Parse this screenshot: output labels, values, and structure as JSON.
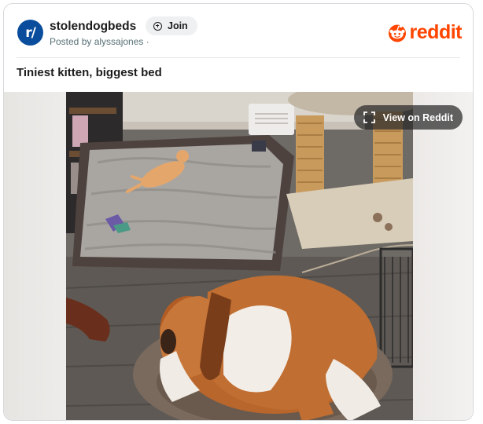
{
  "post": {
    "subreddit": "stolendogbeds",
    "avatar_text": "r/",
    "join_label": "Join",
    "posted_by": "Posted by alyssajones ·",
    "title": "Tiniest kitten, biggest bed"
  },
  "brand": {
    "wordmark": "reddit",
    "color": "#ff4500"
  },
  "media": {
    "view_button_label": "View on Reddit",
    "icon": "expand-icon"
  },
  "colors": {
    "avatar": "#0a4d9c",
    "text": "#1c1c1c",
    "muted": "#576f76"
  }
}
